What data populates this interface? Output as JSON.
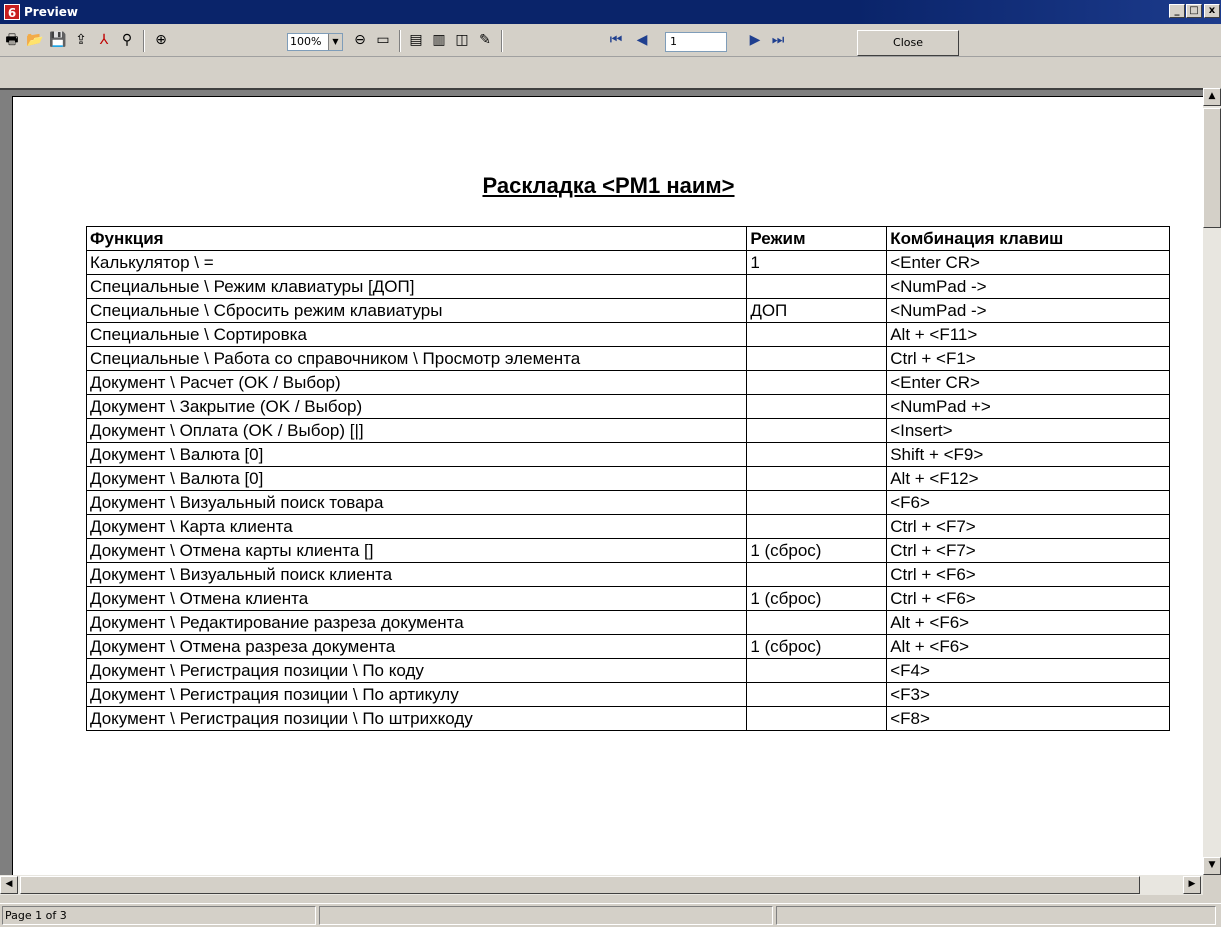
{
  "window": {
    "app_icon_text": "6",
    "title": "Preview",
    "min_glyph": "_",
    "max_glyph": "□",
    "close_glyph": "x"
  },
  "toolbar": {
    "zoom_value": "100%",
    "page_number": "1",
    "close_label": "Close",
    "icons": [
      "print-icon",
      "open-icon",
      "save-icon",
      "export-icon",
      "pdf-icon",
      "find-icon",
      "zoom-in-icon",
      "zoom-out-icon",
      "full-page-icon",
      "page-setup-icon",
      "thumbnails-icon",
      "outline-icon",
      "edit-icon",
      "first-page-icon",
      "prev-page-icon",
      "next-page-icon",
      "last-page-icon"
    ]
  },
  "document": {
    "title": "Раскладка <PM1 наим>",
    "columns": [
      "Функция",
      "Режим",
      "Комбинация клавиш"
    ],
    "rows": [
      {
        "func": "Калькулятор \\ =",
        "mode": "1",
        "keys": "<Enter CR>"
      },
      {
        "func": "Специальные \\ Режим клавиатуры [ДОП]",
        "mode": "",
        "keys": "<NumPad ->"
      },
      {
        "func": "Специальные \\ Сбросить режим клавиатуры",
        "mode": "ДОП",
        "keys": "<NumPad ->"
      },
      {
        "func": "Специальные \\ Сортировка",
        "mode": "",
        "keys": "Alt + <F11>"
      },
      {
        "func": "Специальные \\ Работа со справочником \\ Просмотр элемента",
        "mode": "",
        "keys": "Ctrl + <F1>"
      },
      {
        "func": "Документ \\ Расчет (OK / Выбор)",
        "mode": "",
        "keys": "<Enter CR>"
      },
      {
        "func": "Документ \\ Закрытие (OK / Выбор)",
        "mode": "",
        "keys": "<NumPad +>"
      },
      {
        "func": "Документ \\ Оплата (OK / Выбор) [|]",
        "mode": "",
        "keys": "<Insert>"
      },
      {
        "func": "Документ \\ Валюта [0]",
        "mode": "",
        "keys": "Shift + <F9>"
      },
      {
        "func": "Документ \\ Валюта [0]",
        "mode": "",
        "keys": "Alt + <F12>"
      },
      {
        "func": "Документ \\ Визуальный поиск товара",
        "mode": "",
        "keys": "<F6>"
      },
      {
        "func": "Документ \\ Карта клиента",
        "mode": "",
        "keys": "Ctrl + <F7>"
      },
      {
        "func": "Документ \\ Отмена карты клиента []",
        "mode": "1 (сброс)",
        "keys": "Ctrl + <F7>"
      },
      {
        "func": "Документ \\ Визуальный поиск клиента",
        "mode": "",
        "keys": "Ctrl + <F6>"
      },
      {
        "func": "Документ \\ Отмена клиента",
        "mode": "1 (сброс)",
        "keys": "Ctrl + <F6>"
      },
      {
        "func": "Документ \\ Редактирование разреза документа",
        "mode": "",
        "keys": "Alt + <F6>"
      },
      {
        "func": "Документ \\ Отмена разреза документа",
        "mode": "1 (сброс)",
        "keys": "Alt + <F6>"
      },
      {
        "func": "Документ \\ Регистрация позиции \\ По коду",
        "mode": "",
        "keys": "<F4>"
      },
      {
        "func": "Документ \\ Регистрация позиции \\ По артикулу",
        "mode": "",
        "keys": "<F3>"
      },
      {
        "func": "Документ \\ Регистрация позиции \\ По штрихкоду",
        "mode": "",
        "keys": "<F8>"
      }
    ]
  },
  "statusbar": {
    "page_info": "Page 1 of 3"
  }
}
